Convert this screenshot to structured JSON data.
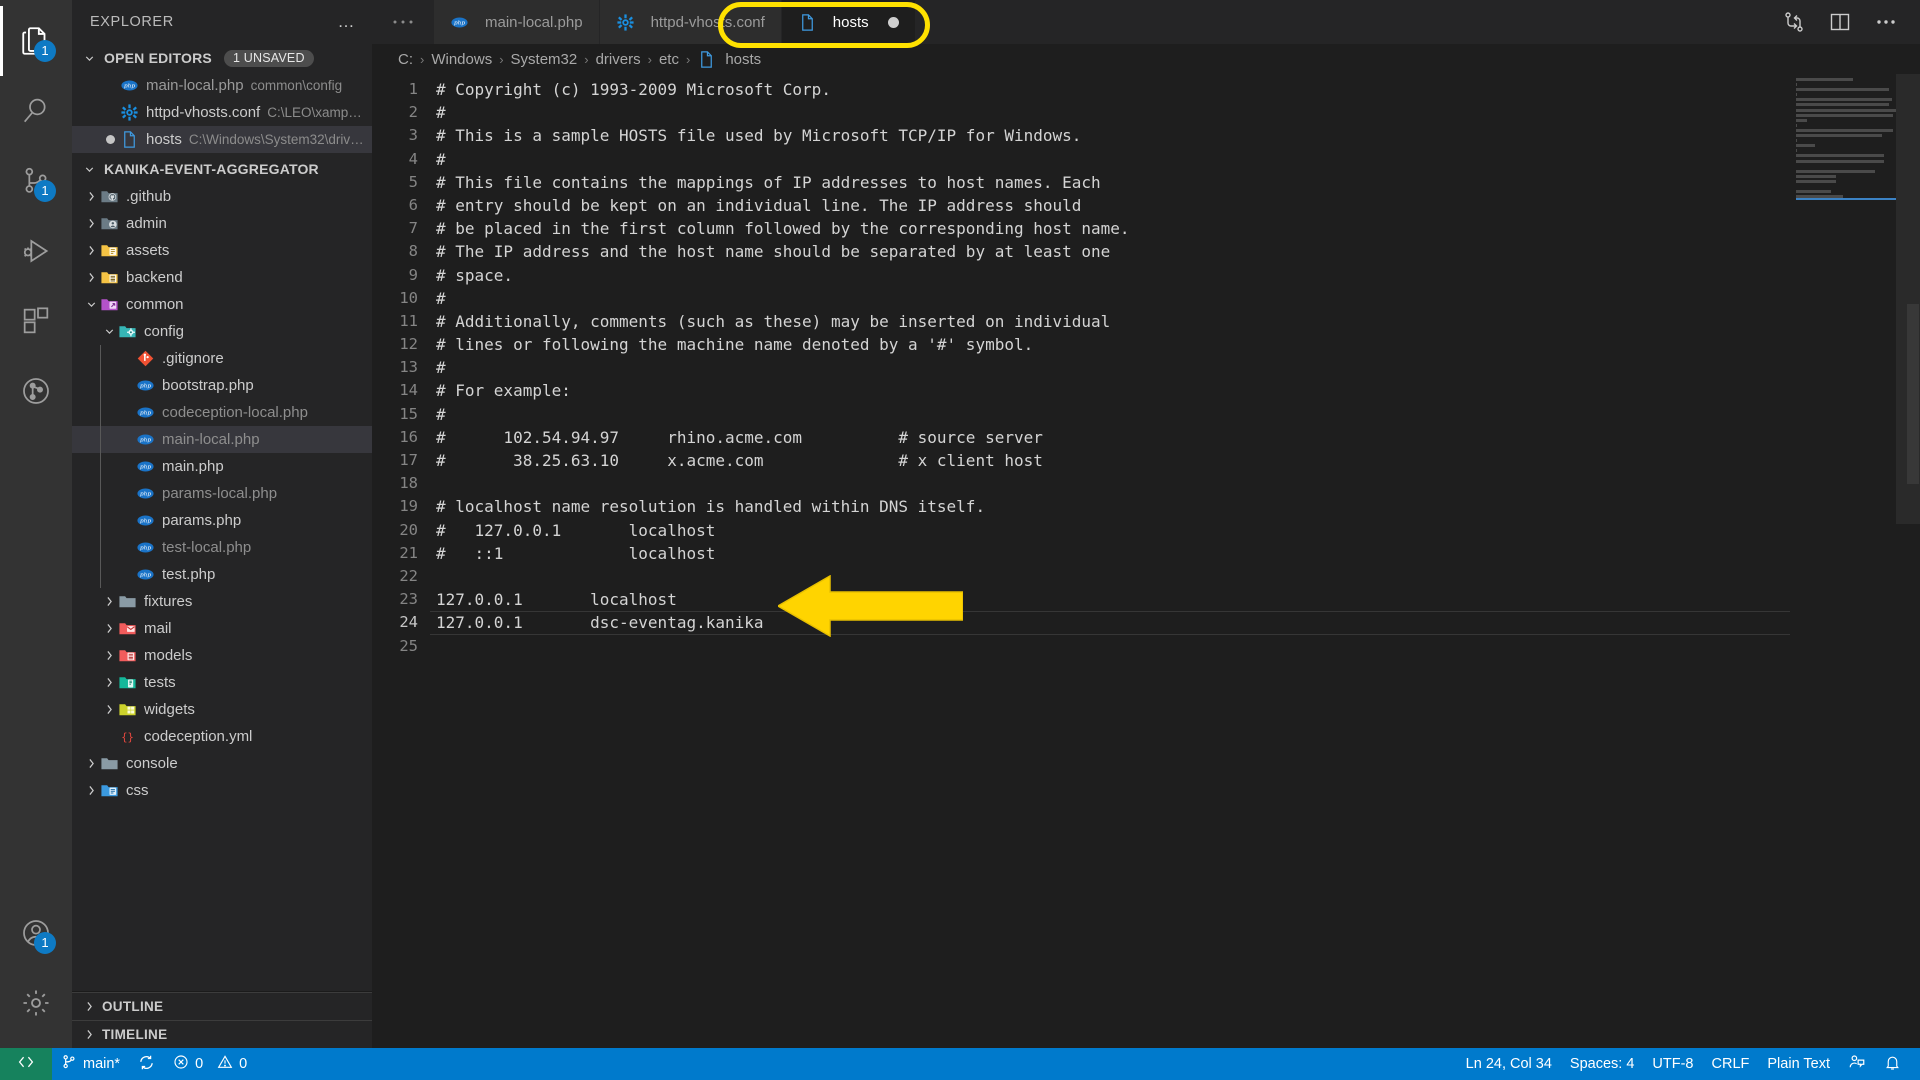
{
  "activitybar": {
    "items": [
      {
        "name": "explorer",
        "icon": "files-icon",
        "badge": "1",
        "active": true
      },
      {
        "name": "search",
        "icon": "search-icon",
        "badge": null,
        "active": false
      },
      {
        "name": "source-control",
        "icon": "source-control-icon",
        "badge": "1",
        "active": false
      },
      {
        "name": "run-and-debug",
        "icon": "run-debug-icon",
        "badge": null,
        "active": false
      },
      {
        "name": "extensions",
        "icon": "extensions-icon",
        "badge": null,
        "active": false
      },
      {
        "name": "git-graph",
        "icon": "git-graph-icon",
        "badge": null,
        "active": false
      }
    ],
    "bottom": [
      {
        "name": "accounts",
        "icon": "account-icon",
        "badge": "1"
      },
      {
        "name": "settings",
        "icon": "gear-icon",
        "badge": null
      }
    ]
  },
  "sidebar": {
    "title": "EXPLORER",
    "more_actions": "…",
    "open_editors": {
      "label": "OPEN EDITORS",
      "badge": "1 UNSAVED",
      "items": [
        {
          "icon": "php-icon",
          "name": "main-local.php",
          "path": "common\\config",
          "dirty": false,
          "selected": false,
          "dim": true
        },
        {
          "icon": "gear-file-icon",
          "name": "httpd-vhosts.conf",
          "path": "C:\\LEO\\xampp\\...",
          "dirty": false,
          "selected": false,
          "dim": false
        },
        {
          "icon": "plain-file-icon",
          "name": "hosts",
          "path": "C:\\Windows\\System32\\driver...",
          "dirty": true,
          "selected": true,
          "dim": false
        }
      ]
    },
    "project": {
      "label": "KANIKA-EVENT-AGGREGATOR",
      "tree": [
        {
          "label": ".github",
          "type": "folder",
          "icon": "github-folder-icon",
          "depth": 1,
          "expanded": false,
          "dim": false
        },
        {
          "label": "admin",
          "type": "folder",
          "icon": "admin-folder-icon",
          "depth": 1,
          "expanded": false,
          "dim": false
        },
        {
          "label": "assets",
          "type": "folder",
          "icon": "assets-folder-icon",
          "depth": 1,
          "expanded": false,
          "dim": false
        },
        {
          "label": "backend",
          "type": "folder",
          "icon": "backend-folder-icon",
          "depth": 1,
          "expanded": false,
          "dim": false
        },
        {
          "label": "common",
          "type": "folder",
          "icon": "common-folder-icon",
          "depth": 1,
          "expanded": true,
          "dim": false
        },
        {
          "label": "config",
          "type": "folder",
          "icon": "config-folder-icon",
          "depth": 2,
          "expanded": true,
          "dim": false
        },
        {
          "label": ".gitignore",
          "type": "file",
          "icon": "git-icon",
          "depth": 3,
          "dim": false
        },
        {
          "label": "bootstrap.php",
          "type": "file",
          "icon": "php-icon",
          "depth": 3,
          "dim": false
        },
        {
          "label": "codeception-local.php",
          "type": "file",
          "icon": "php-icon",
          "depth": 3,
          "dim": true
        },
        {
          "label": "main-local.php",
          "type": "file",
          "icon": "php-icon",
          "depth": 3,
          "dim": true,
          "selected": true
        },
        {
          "label": "main.php",
          "type": "file",
          "icon": "php-icon",
          "depth": 3,
          "dim": false
        },
        {
          "label": "params-local.php",
          "type": "file",
          "icon": "php-icon",
          "depth": 3,
          "dim": true
        },
        {
          "label": "params.php",
          "type": "file",
          "icon": "php-icon",
          "depth": 3,
          "dim": false
        },
        {
          "label": "test-local.php",
          "type": "file",
          "icon": "php-icon",
          "depth": 3,
          "dim": true
        },
        {
          "label": "test.php",
          "type": "file",
          "icon": "php-icon",
          "depth": 3,
          "dim": false
        },
        {
          "label": "fixtures",
          "type": "folder",
          "icon": "plain-folder-icon",
          "depth": 2,
          "expanded": false,
          "dim": false
        },
        {
          "label": "mail",
          "type": "folder",
          "icon": "mail-folder-icon",
          "depth": 2,
          "expanded": false,
          "dim": false
        },
        {
          "label": "models",
          "type": "folder",
          "icon": "models-folder-icon",
          "depth": 2,
          "expanded": false,
          "dim": false
        },
        {
          "label": "tests",
          "type": "folder",
          "icon": "tests-folder-icon",
          "depth": 2,
          "expanded": false,
          "dim": false
        },
        {
          "label": "widgets",
          "type": "folder",
          "icon": "widgets-folder-icon",
          "depth": 2,
          "expanded": false,
          "dim": false
        },
        {
          "label": "codeception.yml",
          "type": "file",
          "icon": "yml-icon",
          "depth": 2,
          "dim": false
        },
        {
          "label": "console",
          "type": "folder",
          "icon": "plain-folder-icon",
          "depth": 1,
          "expanded": false,
          "dim": false
        },
        {
          "label": "css",
          "type": "folder",
          "icon": "css-folder-icon",
          "depth": 1,
          "expanded": false,
          "dim": false
        }
      ]
    },
    "footer": [
      {
        "label": "OUTLINE"
      },
      {
        "label": "TIMELINE"
      }
    ]
  },
  "editor": {
    "tabs": [
      {
        "label": "main-local.php",
        "icon": "php-icon",
        "active": false,
        "dirty": false
      },
      {
        "label": "httpd-vhosts.conf",
        "icon": "gear-file-icon",
        "active": false,
        "dirty": false
      },
      {
        "label": "hosts",
        "icon": "plain-file-icon",
        "active": true,
        "dirty": true
      }
    ],
    "tab_actions": [
      {
        "name": "split-compare-icon"
      },
      {
        "name": "split-editor-icon"
      },
      {
        "name": "more-actions-icon",
        "label": "…"
      }
    ],
    "breadcrumb": [
      "C:",
      "Windows",
      "System32",
      "drivers",
      "etc",
      "hosts"
    ],
    "breadcrumb_separator": "›",
    "current_line": 24,
    "lines": [
      {
        "n": 1,
        "text": "# Copyright (c) 1993-2009 Microsoft Corp."
      },
      {
        "n": 2,
        "text": "#"
      },
      {
        "n": 3,
        "text": "# This is a sample HOSTS file used by Microsoft TCP/IP for Windows."
      },
      {
        "n": 4,
        "text": "#"
      },
      {
        "n": 5,
        "text": "# This file contains the mappings of IP addresses to host names. Each"
      },
      {
        "n": 6,
        "text": "# entry should be kept on an individual line. The IP address should"
      },
      {
        "n": 7,
        "text": "# be placed in the first column followed by the corresponding host name."
      },
      {
        "n": 8,
        "text": "# The IP address and the host name should be separated by at least one"
      },
      {
        "n": 9,
        "text": "# space."
      },
      {
        "n": 10,
        "text": "#"
      },
      {
        "n": 11,
        "text": "# Additionally, comments (such as these) may be inserted on individual"
      },
      {
        "n": 12,
        "text": "# lines or following the machine name denoted by a '#' symbol."
      },
      {
        "n": 13,
        "text": "#"
      },
      {
        "n": 14,
        "text": "# For example:"
      },
      {
        "n": 15,
        "text": "#"
      },
      {
        "n": 16,
        "text": "#      102.54.94.97     rhino.acme.com          # source server"
      },
      {
        "n": 17,
        "text": "#       38.25.63.10     x.acme.com              # x client host"
      },
      {
        "n": 18,
        "text": ""
      },
      {
        "n": 19,
        "text": "# localhost name resolution is handled within DNS itself."
      },
      {
        "n": 20,
        "text": "#   127.0.0.1       localhost"
      },
      {
        "n": 21,
        "text": "#   ::1             localhost"
      },
      {
        "n": 22,
        "text": ""
      },
      {
        "n": 23,
        "text": "127.0.0.1       localhost"
      },
      {
        "n": 24,
        "text": "127.0.0.1       dsc-eventag.kanika"
      },
      {
        "n": 25,
        "text": ""
      }
    ]
  },
  "statusbar": {
    "remote_icon": "remote-window-icon",
    "branch": "main*",
    "branch_icon": "source-control-icon",
    "sync_icon": "sync-icon",
    "errors": "0",
    "warnings": "0",
    "error_icon": "error-icon",
    "warning_icon": "warning-icon",
    "cursor_position": "Ln 24, Col 34",
    "indentation": "Spaces: 4",
    "encoding": "UTF-8",
    "eol": "CRLF",
    "language": "Plain Text",
    "feedback_icon": "feedback-icon",
    "bell_icon": "bell-icon"
  },
  "annotations": {
    "tab_highlight_color": "#ffe100",
    "arrow_color": "#ffd400",
    "target_tab": "hosts",
    "target_line": 24
  }
}
